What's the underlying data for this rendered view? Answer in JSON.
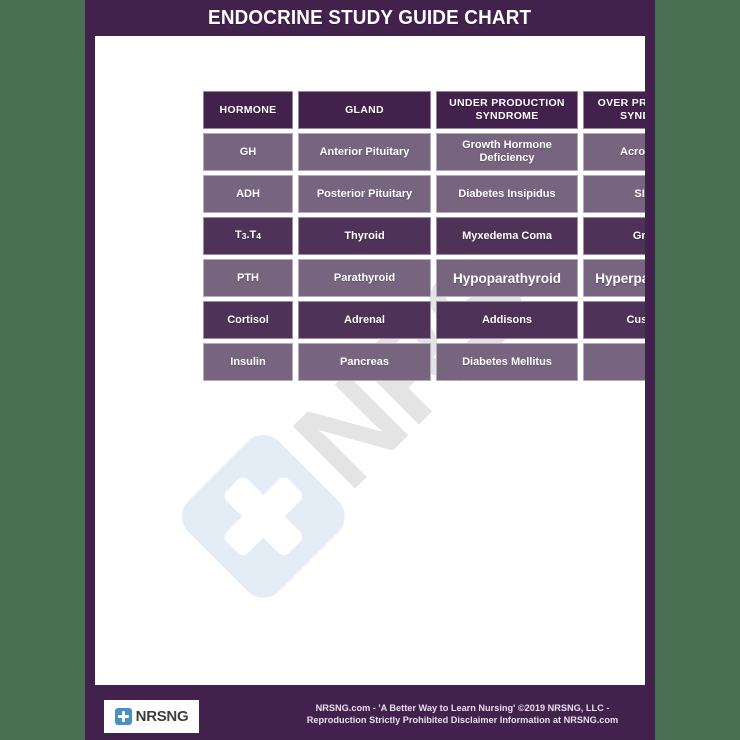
{
  "background_color": "#4a7053",
  "poster": {
    "background_color": "#42214d",
    "title": "ENDOCRINE STUDY GUIDE CHART"
  },
  "watermark": {
    "text": "NRS",
    "square_color": "#e4ecf5",
    "text_color": "#e4e4e4",
    "icon": "plus-cross"
  },
  "table": {
    "header_color": "#42214d",
    "row_dark_color": "#4f3257",
    "row_light_color": "#77657f",
    "columns": [
      "HORMONE",
      "GLAND",
      "UNDER PRODUCTION SYNDROME",
      "OVER PRODUCTION SYNDROME"
    ],
    "headers": [
      {
        "line1": "HORMONE",
        "line2": ""
      },
      {
        "line1": "GLAND",
        "line2": ""
      },
      {
        "line1": "UNDER PRODUCTION",
        "line2": "SYNDROME"
      },
      {
        "line1": "OVER PRODUCTION",
        "line2": "SYNDROME"
      }
    ],
    "rows": [
      {
        "shade": "light",
        "hormone": "GH",
        "gland": "Anterior Pituitary",
        "under": "Growth Hormone Deficiency",
        "over": "Acromegaly"
      },
      {
        "shade": "light",
        "hormone": "ADH",
        "gland": "Posterior Pituitary",
        "under": "Diabetes Insipidus",
        "over": "SIADH"
      },
      {
        "shade": "dark",
        "hormone": "T3.T4",
        "gland": "Thyroid",
        "under": "Myxedema Coma",
        "over": "Graves"
      },
      {
        "shade": "light",
        "hormone": "PTH",
        "gland": "Parathyroid",
        "under": "Hypoparathyroid",
        "over": "Hyperparathyroid"
      },
      {
        "shade": "dark",
        "hormone": "Cortisol",
        "gland": "Adrenal",
        "under": "Addisons",
        "over": "Cushings"
      },
      {
        "shade": "light",
        "hormone": "Insulin",
        "gland": "Pancreas",
        "under": "Diabetes Mellitus",
        "over": ""
      }
    ]
  },
  "footer": {
    "logo_text": "NRSNG",
    "logo_icon": "medical-cross-icon",
    "logo_icon_color": "#4a90c4",
    "disclaimer_line1": "NRSNG.com - 'A Better Way to Learn Nursing' ©2019 NRSNG, LLC -",
    "disclaimer_line2": "Reproduction Strictly Prohibited Disclaimer Information at NRSNG.com"
  }
}
